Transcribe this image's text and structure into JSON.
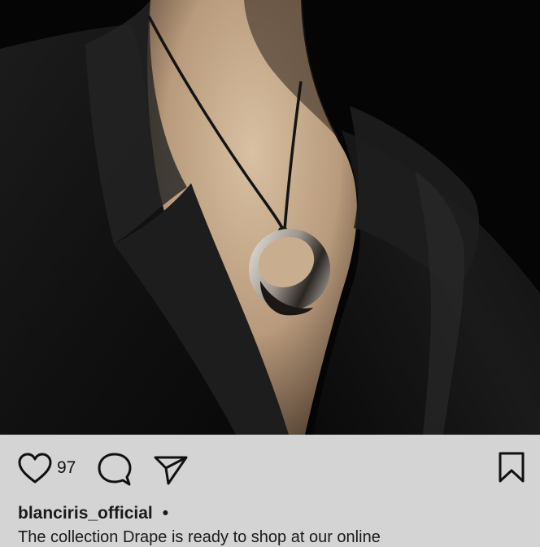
{
  "post": {
    "image": {
      "description_icon": "photo",
      "colors": {
        "background": "#050505",
        "jacket": "#161616",
        "skin": "#cdb396",
        "silver": "#c9c4be"
      }
    },
    "actions": {
      "like_icon": "heart-outline-icon",
      "like_count": "97",
      "comment_icon": "speech-bubble-icon",
      "share_icon": "paper-plane-icon",
      "save_icon": "bookmark-outline-icon"
    },
    "username": "blanciris_official",
    "separator": "•",
    "caption": "The collection Drape is ready to shop at our online"
  },
  "colors": {
    "panel_bg": "#d4d4d4",
    "text": "#111111"
  }
}
